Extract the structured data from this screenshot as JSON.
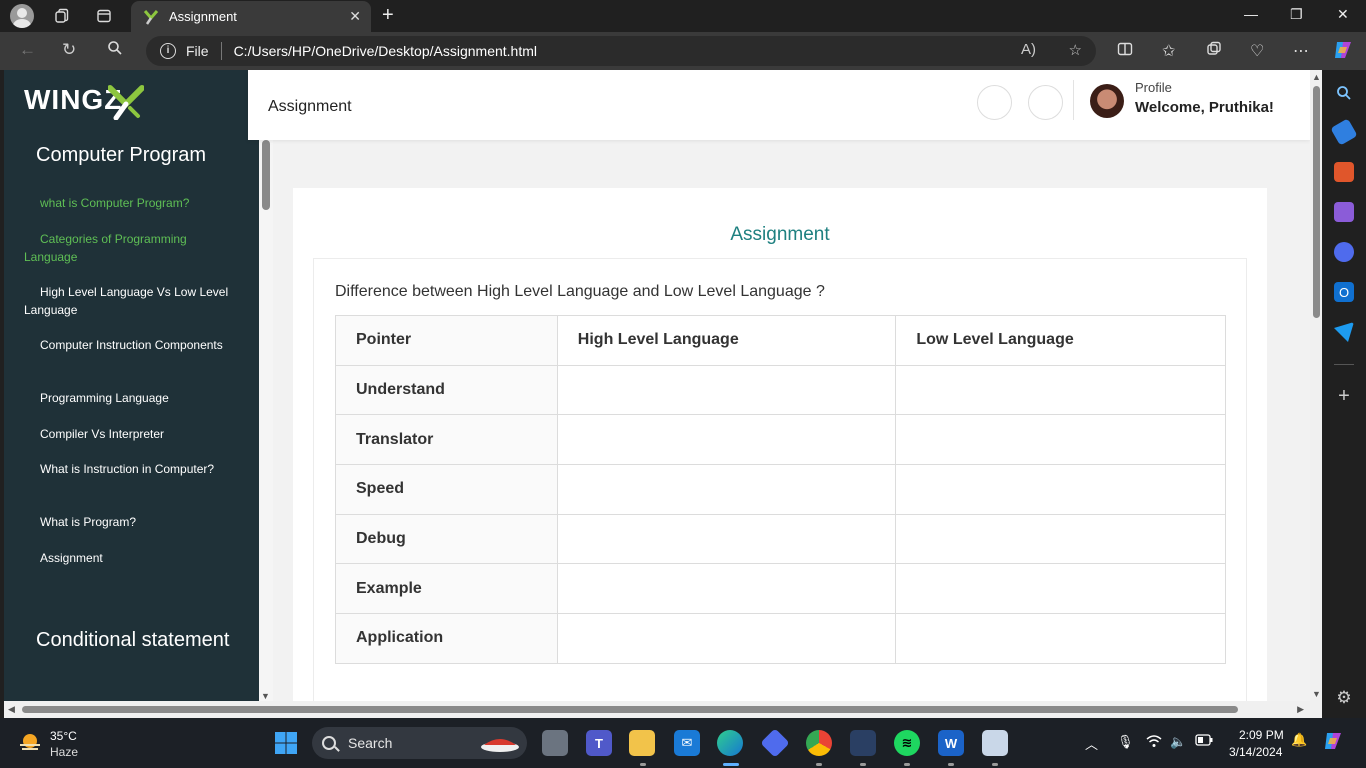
{
  "browser": {
    "tab_title": "Assignment",
    "tab_favicon": "wingz-favicon",
    "url_scheme": "File",
    "url": "C:/Users/HP/OneDrive/Desktop/Assignment.html"
  },
  "logo": {
    "text": "WINGZ",
    "mark_color": "#8dc63f"
  },
  "sidebar": {
    "section_1_heading": "Computer Program",
    "items": [
      {
        "label": "what is Computer Program?",
        "active": true,
        "tail": true
      },
      {
        "label": "Categories of Programming Language",
        "active": true,
        "tail": true
      },
      {
        "label": "High Level Language Vs Low Level Language",
        "active": false,
        "tail": true
      },
      {
        "label": "Computer Instruction Components",
        "active": false,
        "tail": false
      },
      {
        "label": "Programming Language",
        "active": false,
        "tail": false
      },
      {
        "label": "Compiler Vs Interpreter",
        "active": false,
        "tail": false
      },
      {
        "label": "What is Instruction in Computer?",
        "active": false,
        "tail": false
      },
      {
        "label": "What is Program?",
        "active": false,
        "tail": false
      },
      {
        "label": "Assignment",
        "active": false,
        "tail": false
      }
    ],
    "section_2_heading": "Conditional statement",
    "glyph": "",
    "active_color": "#5fbf55",
    "bg_color": "#1f3138"
  },
  "header": {
    "title": "Assignment",
    "button_glyph": "",
    "profile_label": "Profile",
    "welcome": "Welcome, Pruthika!",
    "caret": ""
  },
  "main": {
    "card_title": "Assignment",
    "question": "Difference between High Level Language and Low Level Language ?",
    "table": {
      "columns": [
        "Pointer",
        "High Level Language",
        "Low Level Language"
      ],
      "rows": [
        [
          "Understand",
          "",
          ""
        ],
        [
          "Translator",
          "",
          ""
        ],
        [
          "Speed",
          "",
          ""
        ],
        [
          "Debug",
          "",
          ""
        ],
        [
          "Example",
          "",
          ""
        ],
        [
          "Application",
          "",
          ""
        ]
      ]
    },
    "accent_color": "#1e8080"
  },
  "taskbar": {
    "temperature": "35°C",
    "condition": "Haze",
    "search_placeholder": "Search",
    "time": "2:09 PM",
    "date": "3/14/2024"
  }
}
